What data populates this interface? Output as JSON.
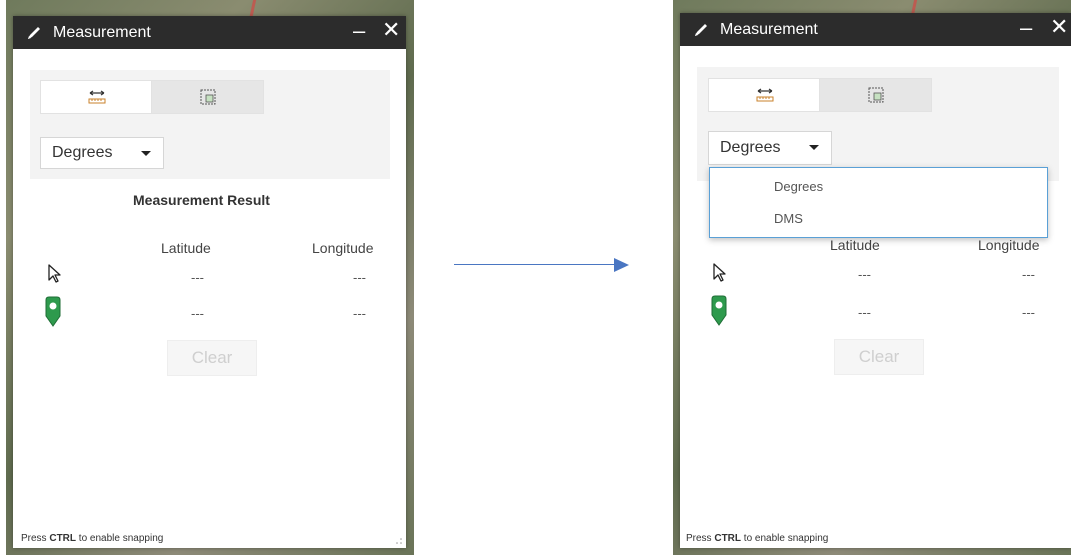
{
  "panel_title": "Measurement",
  "minimize_symbol": "–",
  "close_symbol": "✕",
  "tabs": [
    {
      "icon": "distance-ruler-icon"
    },
    {
      "icon": "area-grid-icon"
    }
  ],
  "unit_select": {
    "value": "Degrees"
  },
  "result_title": "Measurement Result",
  "columns": {
    "latitude": "Latitude",
    "longitude": "Longitude"
  },
  "rows": [
    {
      "icon": "mouse-pointer-icon",
      "latitude": "---",
      "longitude": "---"
    },
    {
      "icon": "map-pin-icon",
      "latitude": "---",
      "longitude": "---"
    }
  ],
  "clear_label": "Clear",
  "hint": {
    "prefix": "Press ",
    "key": "CTRL",
    "suffix": " to enable snapping"
  },
  "dropdown_options": [
    "Degrees",
    "DMS"
  ],
  "colors": {
    "titlebar": "#2c2c2c",
    "pin": "#2e9a4d",
    "accent_arrow": "#4a76c2",
    "dropdown_border": "#5aa0d6"
  }
}
